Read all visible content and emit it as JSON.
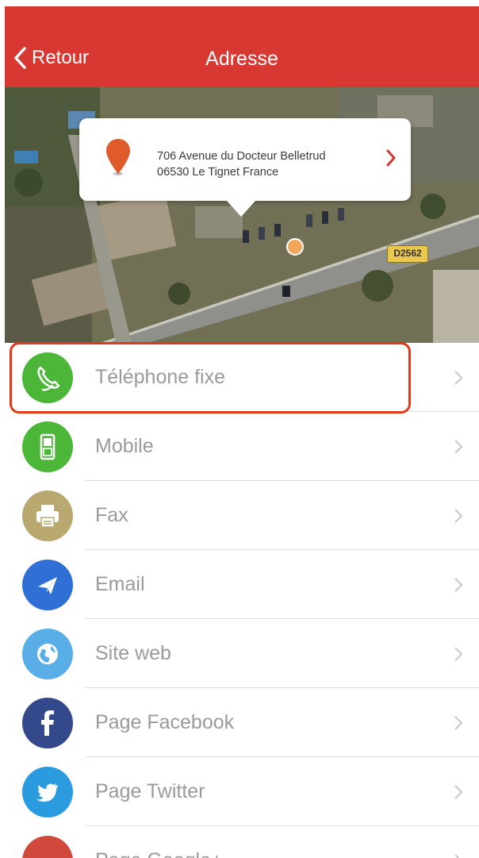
{
  "header": {
    "back_label": "Retour",
    "title": "Adresse"
  },
  "map": {
    "address_line1": "706 Avenue du Docteur Belletrud",
    "address_line2": "06530 Le Tignet France",
    "road_label": "D2562"
  },
  "list": {
    "items": [
      {
        "label": "Téléphone fixe",
        "icon": "landline-phone-icon",
        "color": "#4cb638"
      },
      {
        "label": "Mobile",
        "icon": "mobile-phone-icon",
        "color": "#4cb638"
      },
      {
        "label": "Fax",
        "icon": "fax-icon",
        "color": "#b9a870"
      },
      {
        "label": "Email",
        "icon": "paper-plane-icon",
        "color": "#2f6fd6"
      },
      {
        "label": "Site web",
        "icon": "globe-icon",
        "color": "#5aaee8"
      },
      {
        "label": "Page Facebook",
        "icon": "facebook-icon",
        "color": "#34488c"
      },
      {
        "label": "Page Twitter",
        "icon": "twitter-icon",
        "color": "#2b9be0"
      },
      {
        "label": "Page Google+",
        "icon": "google-plus-icon",
        "color": "#d1493d"
      }
    ]
  },
  "colors": {
    "accent": "#d83832",
    "highlight_border": "#e03a16"
  }
}
